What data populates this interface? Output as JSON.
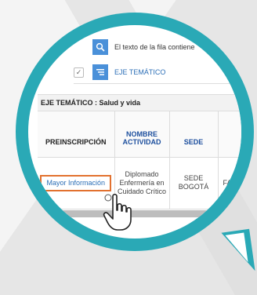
{
  "toolbar": {
    "search_text": "El texto de la fila contiene",
    "eje_label": "EJE TEMÁTICO",
    "checkbox_mark": "✓"
  },
  "group": {
    "header": "EJE TEMÁTICO : Salud y vida"
  },
  "table": {
    "headers": {
      "preinscripcion": "PREINSCRIPCIÓN",
      "nombre_actividad": "NOMBRE ACTIVIDAD",
      "sede": "SEDE"
    },
    "row": {
      "info_button": "Mayor Información",
      "nombre_actividad": "Diplomado Enfermería en Cuidado Crítico",
      "sede": "SEDE BOGOTÁ",
      "partial": "FA ENF"
    }
  },
  "colors": {
    "ring": "#2aa9b6",
    "button_blue": "#4a90d9",
    "link_blue": "#2c6fb7",
    "highlight_orange": "#e2712f"
  },
  "icons": [
    "search-icon",
    "list-icon",
    "check-icon",
    "hand-cursor-icon"
  ]
}
